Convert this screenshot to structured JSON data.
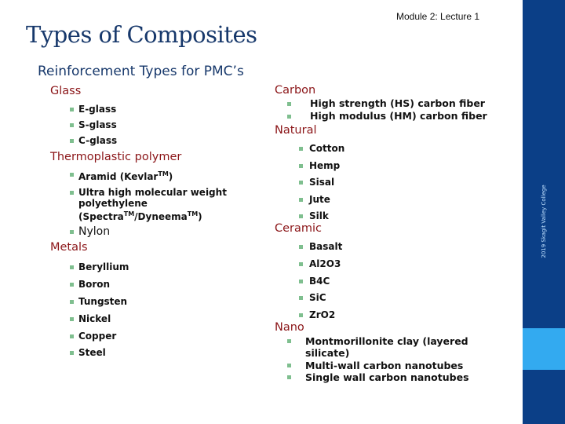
{
  "header": {
    "module_label": "Module 2: Lecture 1",
    "title": "Types of Composites",
    "subtitle": "Reinforcement Types for PMC’s"
  },
  "sidebar": {
    "credit": "2019 Skagit Valley College",
    "colors": {
      "background": "#0b3f87",
      "accent": "#33aaf0"
    }
  },
  "colors": {
    "title": "#17386b",
    "category": "#8b1518",
    "bullet": "#7fbf8f",
    "item_text": "#111111"
  },
  "left_column": {
    "glass": {
      "label": "Glass",
      "items": [
        "E-glass",
        "S-glass",
        "C-glass"
      ]
    },
    "thermoplastic": {
      "label": "Thermoplastic polymer",
      "items": [
        {
          "text": "Aramid (Kevlar",
          "tm": "TM",
          "close": ")"
        },
        {
          "line1": "Ultra high molecular weight",
          "line2": "polyethylene",
          "line3a": "(Spectra",
          "tm1": "TM",
          "line3b": "/Dyneema",
          "tm2": "TM",
          "line3c": ")"
        },
        {
          "text": "Nylon"
        }
      ]
    },
    "metals": {
      "label": "Metals",
      "items": [
        "Beryllium",
        "Boron",
        "Tungsten",
        "Nickel",
        "Copper",
        "Steel"
      ]
    }
  },
  "right_column": {
    "carbon": {
      "label": "Carbon",
      "items": [
        "High strength (HS) carbon fiber",
        "High modulus (HM) carbon fiber"
      ]
    },
    "natural": {
      "label": "Natural",
      "items": [
        "Cotton",
        "Hemp",
        "Sisal",
        "Jute",
        "Silk"
      ]
    },
    "ceramic": {
      "label": "Ceramic",
      "items": [
        "Basalt",
        "Al2O3",
        "B4C",
        "SiC",
        "ZrO2"
      ]
    },
    "nano": {
      "label": "Nano",
      "items": [
        {
          "line1": "Montmorillonite clay (layered",
          "line2": "silicate)"
        },
        {
          "line1": "Multi-wall carbon nanotubes"
        },
        {
          "line1": "Single wall carbon nanotubes"
        }
      ]
    }
  }
}
